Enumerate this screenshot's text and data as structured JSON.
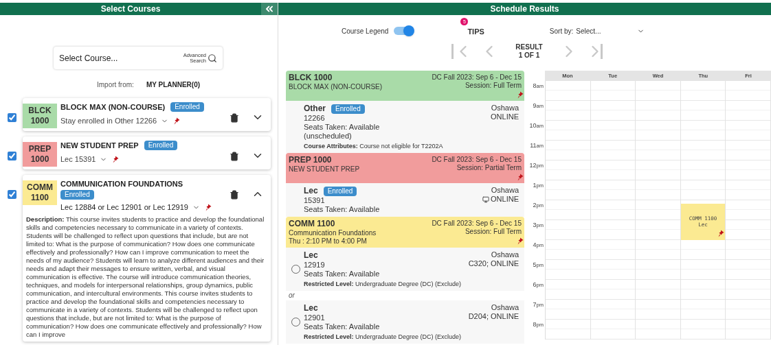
{
  "left_panel": {
    "title": "Select Courses"
  },
  "search": {
    "placeholder": "Select Course...",
    "advanced_label": "Advanced Search"
  },
  "import": {
    "label": "Import from:",
    "source": "MY PLANNER(0)"
  },
  "courses": [
    {
      "subject": "BLCK",
      "number": "1000",
      "color": "#a9dba8",
      "checked": true,
      "title": "BLOCK MAX (NON-COURSE)",
      "status": "Enrolled",
      "sections": "Stay enrolled in Other 12266",
      "expanded": false
    },
    {
      "subject": "PREP",
      "number": "1000",
      "color": "#f19c9c",
      "checked": true,
      "title": "NEW STUDENT PREP",
      "status": "Enrolled",
      "sections": "Lec 15391",
      "expanded": false
    },
    {
      "subject": "COMM",
      "number": "1100",
      "color": "#fbea92",
      "checked": true,
      "title": "COMMUNICATION FOUNDATIONS",
      "status": "Enrolled",
      "sections": "Lec 12884 or Lec 12901 or Lec 12919",
      "expanded": true,
      "description": "**Description:** This course invites students to practice and develop the foundational skills and competencies necessary to communicate in a variety of contexts. Students will be challenged to reflect upon questions that include, but are not limited to: What is the purpose of communication? How does one communicate effectively and professionally? How can I improve communication to meet the needs of my audience? Students will learn to analyze different audiences and their needs and adapt their messages to ensure written, verbal, and visual communication is effective. The course will introduce communication theories, techniques, and models for interpersonal relationships, group dynamics, public communication, and intercultural environments. This course invites students to practice and develop the foundational skills and competencies necessary to communicate in a variety of contexts. Students will be challenged to reflect upon questions that include, but are not limited to: What is the purpose of communication? How does one communicate effectively and professionally? How can I improve"
    }
  ],
  "schedule": {
    "title": "Schedule Results",
    "legend": {
      "label": "Course Legend",
      "on": true
    },
    "tips": {
      "label": "TIPS",
      "count": "5"
    },
    "sort": {
      "label": "Sort by:",
      "value": "Select..."
    },
    "result": "RESULT 1 OF 1",
    "nav_buttons": [
      {
        "kind": "first",
        "disabled": true
      },
      {
        "kind": "prev",
        "disabled": true
      },
      {
        "kind": "next",
        "disabled": true
      },
      {
        "kind": "last",
        "disabled": true
      }
    ]
  },
  "results": [
    {
      "code": "BLCK 1000",
      "title": "BLOCK MAX (NON-COURSE)",
      "term": "DC Fall 2023: Sep 6 - Dec 15",
      "session": "Session: Full Term",
      "color": "#a9dba8",
      "options": [
        {
          "type": "Other",
          "status": "Enrolled",
          "crn": "12266",
          "seats": "Seats Taken: Available",
          "extra": "(unscheduled)",
          "campus": "Oshawa",
          "location": "ONLINE",
          "location_icon": false,
          "note_label": "Course Attributes:",
          "note": "Course not eligible for T2202A"
        }
      ]
    },
    {
      "code": "PREP 1000",
      "title": "NEW STUDENT PREP",
      "term": "DC Fall 2023: Sep 6 - Dec 15",
      "session": "Session: Partial Term",
      "color": "#f19c9c",
      "options": [
        {
          "type": "Lec",
          "status": "Enrolled",
          "crn": "15391",
          "seats": "Seats Taken: Available",
          "campus": "Oshawa",
          "location": "ONLINE",
          "location_icon": true
        }
      ]
    },
    {
      "code": "COMM 1100",
      "title": "Communication Foundations",
      "meeting": "Thu : 2:10 PM to 4:00 PM",
      "term": "DC Fall 2023: Sep 6 - Dec 15",
      "session": "Session: Full Term",
      "color": "#fbea92",
      "separator": "or",
      "options": [
        {
          "type": "Lec",
          "selected": false,
          "crn": "12919",
          "seats": "Seats Taken: Available",
          "campus": "Oshawa",
          "location": "C320; ONLINE",
          "location_icon": false,
          "note_label": "Restricted Level:",
          "note": "Undergraduate Degree (DC) (Exclude)"
        },
        {
          "type": "Lec",
          "selected": false,
          "crn": "12901",
          "seats": "Seats Taken: Available",
          "campus": "Oshawa",
          "location": "D204; ONLINE",
          "location_icon": false,
          "note_label": "Restricted Level:",
          "note": "Undergraduate Degree (DC) (Exclude)"
        }
      ]
    }
  ],
  "calendar": {
    "hours": [
      {
        "hour": "8",
        "period": "am"
      },
      {
        "hour": "9",
        "period": "am"
      },
      {
        "hour": "10",
        "period": "am"
      },
      {
        "hour": "11",
        "period": "am"
      },
      {
        "hour": "12",
        "period": "pm"
      },
      {
        "hour": "1",
        "period": "pm"
      },
      {
        "hour": "2",
        "period": "pm"
      },
      {
        "hour": "3",
        "period": "pm"
      },
      {
        "hour": "4",
        "period": "pm"
      },
      {
        "hour": "5",
        "period": "pm"
      },
      {
        "hour": "6",
        "period": "pm"
      },
      {
        "hour": "7",
        "period": "pm"
      },
      {
        "hour": "8",
        "period": "pm"
      }
    ],
    "days": [
      {
        "label": "Mon"
      },
      {
        "label": "Tue"
      },
      {
        "label": "Wed"
      },
      {
        "label": "Thu",
        "events": [
          {
            "title": "COMM 1100",
            "subtitle": "Lec",
            "color": "#fbea92"
          }
        ]
      },
      {
        "label": "Fri"
      }
    ]
  }
}
